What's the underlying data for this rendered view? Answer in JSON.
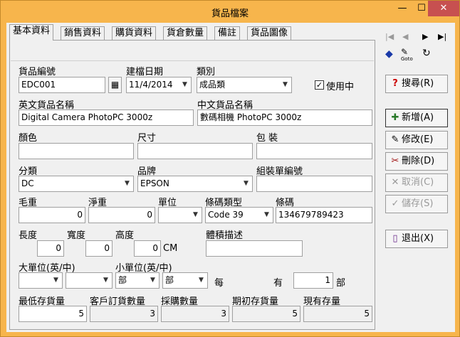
{
  "window": {
    "title": "貨品檔案",
    "min_glyph": "—",
    "max_glyph": "☐",
    "close_glyph": "✕"
  },
  "tabs": [
    "基本資料",
    "銷售資料",
    "購貨資料",
    "貨倉數量",
    "備註",
    "貨品圖像"
  ],
  "form": {
    "item_code_label": "貨品編號",
    "item_code": "EDC001",
    "created_date_label": "建檔日期",
    "created_date": "11/4/2014",
    "category_label": "類別",
    "category": "成品類",
    "in_use_label": "使用中",
    "in_use_checked": true,
    "en_name_label": "英文貨品名稱",
    "en_name": "Digital Camera PhotoPC 3000z",
    "cn_name_label": "中文貨品名稱",
    "cn_name": "數碼相機 PhotoPC 3000z",
    "color_label": "顏色",
    "size_label": "尺寸",
    "packing_label": "包 裝",
    "classification_label": "分類",
    "classification": "DC",
    "brand_label": "品牌",
    "brand": "EPSON",
    "assembly_no_label": "組裝單編號",
    "gross_weight_label": "毛重",
    "gross_weight": "0",
    "net_weight_label": "淨重",
    "net_weight": "0",
    "unit_label": "單位",
    "barcode_type_label": "條碼類型",
    "barcode_type": "Code 39",
    "barcode_label": "條碼",
    "barcode": "134679789423",
    "length_label": "長度",
    "length": "0",
    "width_label": "寬度",
    "width": "0",
    "height_label": "高度",
    "height": "0",
    "cm_unit": "CM",
    "volume_desc_label": "體積描述",
    "big_unit_label": "大單位(英/中)",
    "small_unit_label": "小單位(英/中)",
    "small_unit_en": "部",
    "small_unit_cn": "部",
    "each_label": "每",
    "have_label": "有",
    "qty_per": "1",
    "qty_unit": "部",
    "min_stock_label": "最低存貨量",
    "min_stock": "5",
    "cust_order_label": "客戶訂貨數量",
    "cust_order": "3",
    "purchase_qty_label": "採購數量",
    "purchase_qty": "3",
    "opening_stock_label": "期初存貨量",
    "opening_stock": "5",
    "current_stock_label": "現有存量",
    "current_stock": "5"
  },
  "sidebar": {
    "nav": {
      "first": "|◀",
      "prev": "◀",
      "next": "▶",
      "last": "▶|"
    },
    "goto_label": "Goto",
    "buttons": {
      "search": "搜尋(R)",
      "new": "新增(A)",
      "edit": "修改(E)",
      "delete": "刪除(D)",
      "cancel": "取消(C)",
      "save": "儲存(S)",
      "exit": "退出(X)"
    }
  }
}
